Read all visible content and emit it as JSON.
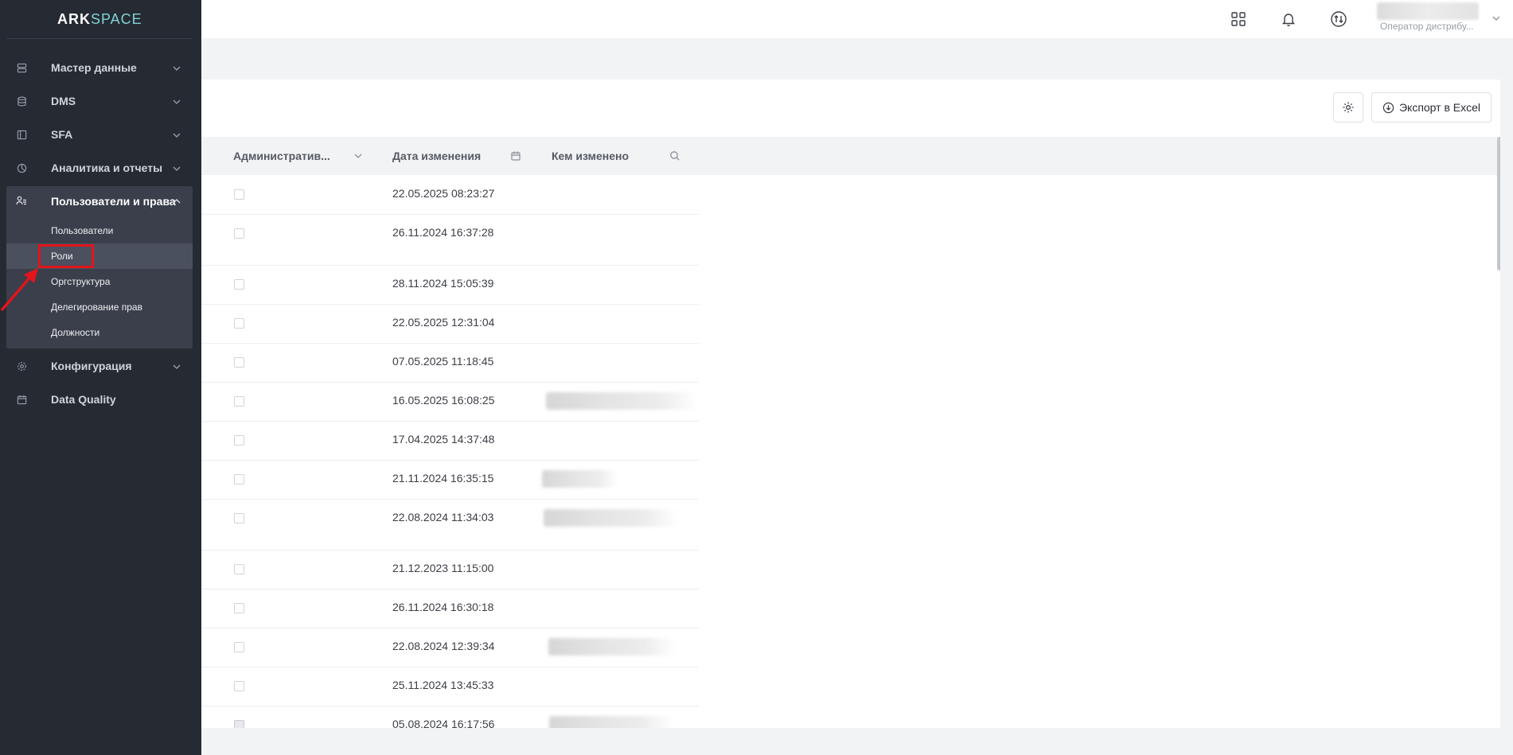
{
  "app": {
    "logo_main": "ARK",
    "logo_accent": "SPACE"
  },
  "topbar": {
    "icons": [
      "apps-grid-icon",
      "bell-icon",
      "sync-icon"
    ],
    "user_role": "Оператор дистрибу..."
  },
  "sidebar": {
    "items": [
      {
        "label": "Мастер данные",
        "icon": "server-icon",
        "expandable": true
      },
      {
        "label": "DMS",
        "icon": "database-icon",
        "expandable": true
      },
      {
        "label": "SFA",
        "icon": "layout-icon",
        "expandable": true
      },
      {
        "label": "Аналитика и отчеты",
        "icon": "pie-chart-icon",
        "expandable": true
      }
    ],
    "open_group": {
      "label": "Пользователи и права",
      "icon": "users-icon",
      "children": [
        "Пользователи",
        "Роли",
        "Оргструктура",
        "Делегирование прав",
        "Должности"
      ],
      "active": "Роли"
    },
    "items_after": [
      {
        "label": "Конфигурация",
        "icon": "gear-icon",
        "expandable": true
      },
      {
        "label": "Data Quality",
        "icon": "calendar-icon",
        "expandable": false
      }
    ]
  },
  "toolbar": {
    "export_label": "Экспорт в Excel"
  },
  "table": {
    "columns": [
      {
        "label": "Административ...",
        "icon": "chevron-down-icon"
      },
      {
        "label": "Дата изменения",
        "icon": "calendar-icon"
      },
      {
        "label": "Кем изменено",
        "icon": "search-icon"
      }
    ],
    "rows": [
      {
        "admin": false,
        "date": "22.05.2025 08:23:27",
        "changed_by_redacted": false
      },
      {
        "admin": false,
        "date": "26.11.2024 16:37:28",
        "changed_by_redacted": false
      },
      {
        "admin": false,
        "date": "28.11.2024 15:05:39",
        "changed_by_redacted": false
      },
      {
        "admin": false,
        "date": "22.05.2025 12:31:04",
        "changed_by_redacted": false
      },
      {
        "admin": false,
        "date": "07.05.2025 11:18:45",
        "changed_by_redacted": false
      },
      {
        "admin": false,
        "date": "16.05.2025 16:08:25",
        "changed_by_redacted": true
      },
      {
        "admin": false,
        "date": "17.04.2025 14:37:48",
        "changed_by_redacted": false
      },
      {
        "admin": false,
        "date": "21.11.2024 16:35:15",
        "changed_by_redacted": true
      },
      {
        "admin": false,
        "date": "22.08.2024 11:34:03",
        "changed_by_redacted": true
      },
      {
        "admin": false,
        "date": "21.12.2023 11:15:00",
        "changed_by_redacted": false
      },
      {
        "admin": false,
        "date": "26.11.2024 16:30:18",
        "changed_by_redacted": false
      },
      {
        "admin": false,
        "date": "22.08.2024 12:39:34",
        "changed_by_redacted": true
      },
      {
        "admin": false,
        "date": "25.11.2024 13:45:33",
        "changed_by_redacted": false
      },
      {
        "admin": true,
        "date": "05.08.2024 16:17:56",
        "changed_by_redacted": true
      }
    ]
  }
}
